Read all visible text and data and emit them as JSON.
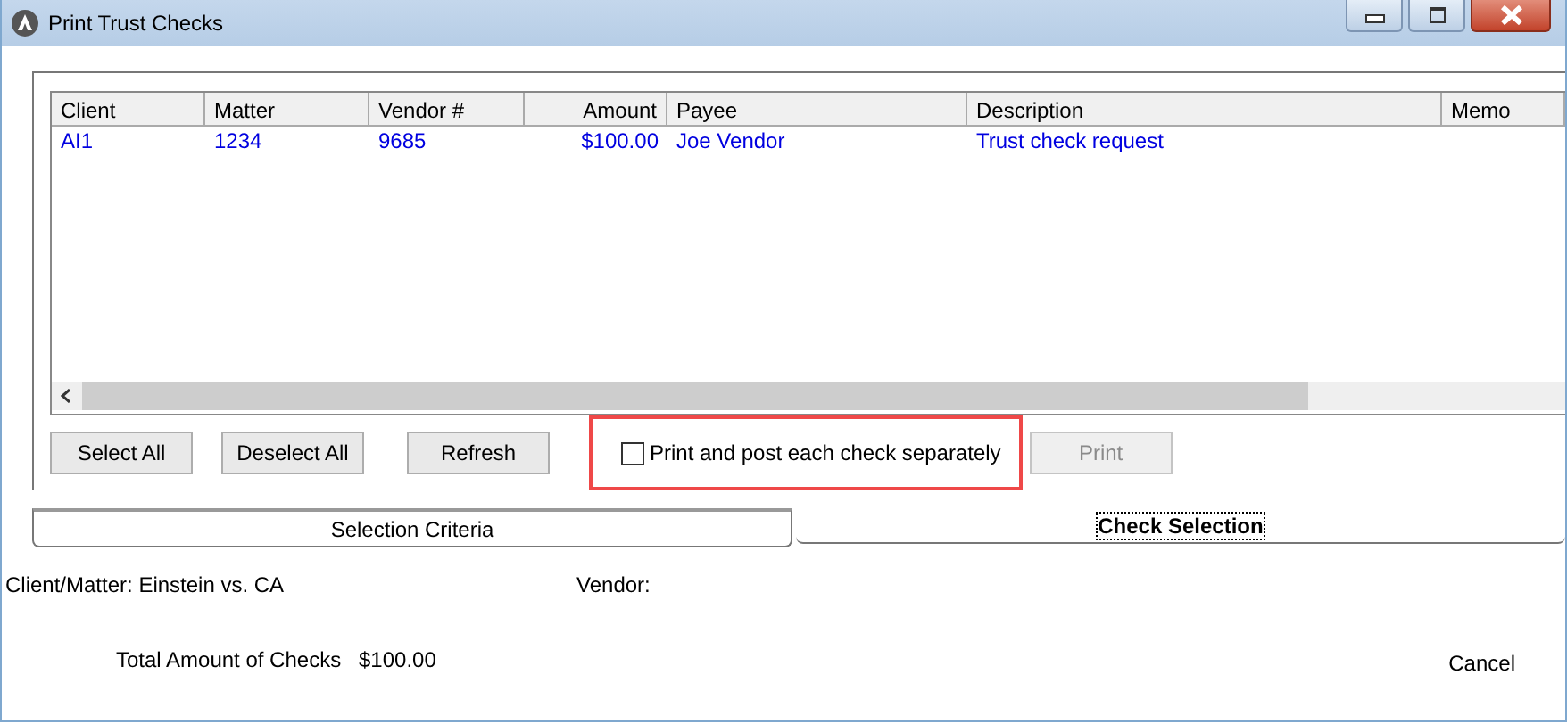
{
  "window": {
    "title": "Print Trust Checks"
  },
  "table": {
    "columns": [
      {
        "label": "Client",
        "kind": "text"
      },
      {
        "label": "Matter",
        "kind": "text"
      },
      {
        "label": "Vendor #",
        "kind": "text"
      },
      {
        "label": "Amount",
        "kind": "money"
      },
      {
        "label": "Payee",
        "kind": "text"
      },
      {
        "label": "Description",
        "kind": "text"
      },
      {
        "label": "Memo",
        "kind": "text"
      }
    ],
    "rows": [
      {
        "cells": [
          "AI1",
          "1234",
          "9685",
          "$100.00",
          "Joe Vendor",
          "Trust check request",
          ""
        ]
      }
    ]
  },
  "buttons": [
    {
      "label": "Select All",
      "disabled": false
    },
    {
      "label": "Deselect All",
      "disabled": false
    },
    {
      "label": "Refresh",
      "disabled": false
    }
  ],
  "separate_checkbox": {
    "label": "Print and post each check separately",
    "checked": false,
    "highlighted": true
  },
  "print_button": {
    "label": "Print",
    "disabled": true
  },
  "tabs": [
    {
      "label": "Selection Criteria",
      "selected": false
    },
    {
      "label": "Check Selection",
      "selected": true
    }
  ],
  "summary": {
    "client_matter": "Client/Matter: Einstein vs. CA",
    "vendor": "Vendor:",
    "total_label": "Total Amount of Checks",
    "total_value": "$100.00"
  },
  "cancel": {
    "label": "Cancel"
  }
}
